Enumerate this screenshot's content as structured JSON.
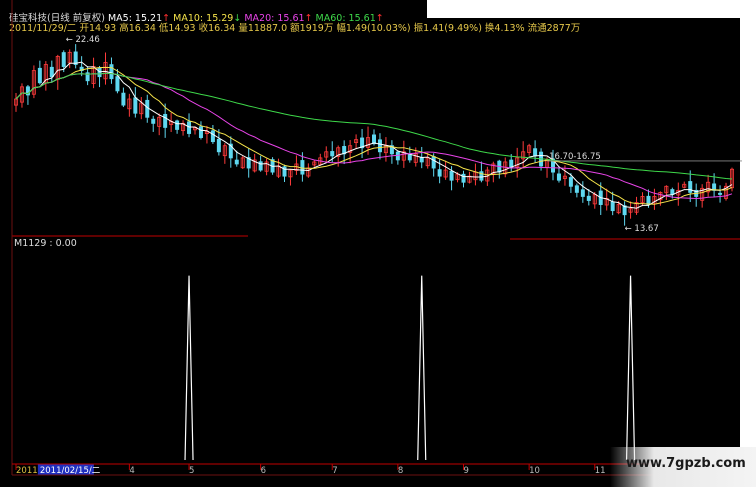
{
  "header": {
    "stock_name": "硅宝科技(日线 前复权)",
    "ma": [
      {
        "label": "MA5: 15.21",
        "arrow": "↑",
        "color": "#ffffff"
      },
      {
        "label": "MA10: 15.29",
        "arrow": "↓",
        "color": "#f5e34a"
      },
      {
        "label": "MA20: 15.61",
        "arrow": "↑",
        "color": "#e844e8"
      },
      {
        "label": "MA60: 15.61",
        "arrow": "↑",
        "color": "#3ed84a"
      }
    ],
    "bar_info": "2011/11/29/二 开14.93 高16.34 低14.93 收16.34 量11887.0 额1919万 幅1.49(10.03%) 振1.41(9.49%) 换4.13% 流通2877万"
  },
  "chart_data": {
    "type": "candlestick",
    "price": {
      "annotations": {
        "high": "← 22.46",
        "low": "← 13.67",
        "box": "16.70-16.75"
      },
      "series": [
        {
          "name": "MA5",
          "color": "#ffffff"
        },
        {
          "name": "MA10",
          "color": "#f5e34a"
        },
        {
          "name": "MA20",
          "color": "#e844e8"
        },
        {
          "name": "MA60",
          "color": "#3ed84a"
        }
      ],
      "close": [
        19.8,
        20.4,
        20.0,
        21.2,
        20.6,
        21.5,
        20.9,
        21.9,
        21.4,
        22.1,
        21.5,
        21.2,
        20.7,
        21.4,
        20.9,
        21.6,
        20.8,
        20.2,
        19.5,
        19.8,
        19.1,
        19.6,
        18.9,
        18.6,
        18.9,
        18.4,
        18.7,
        18.3,
        18.6,
        18.1,
        18.4,
        17.9,
        18.2,
        17.7,
        17.2,
        17.5,
        16.9,
        16.6,
        16.9,
        16.4,
        16.8,
        16.3,
        16.7,
        16.2,
        16.5,
        16.0,
        16.3,
        16.6,
        16.1,
        16.4,
        16.7,
        16.9,
        17.2,
        17.0,
        17.4,
        17.1,
        17.5,
        17.8,
        17.4,
        17.9,
        17.6,
        17.2,
        17.5,
        17.1,
        16.8,
        17.2,
        16.8,
        17.1,
        16.7,
        16.9,
        16.4,
        16.0,
        16.3,
        15.8,
        16.1,
        15.7,
        16.0,
        16.2,
        15.8,
        16.3,
        16.6,
        16.2,
        16.7,
        16.4,
        16.9,
        17.2,
        17.5,
        17.0,
        16.5,
        16.8,
        16.2,
        15.8,
        16.0,
        15.5,
        15.2,
        15.0,
        14.8,
        15.1,
        14.6,
        14.9,
        14.3,
        14.6,
        14.1,
        14.4,
        14.7,
        15.0,
        14.6,
        15.0,
        15.2,
        15.5,
        15.1,
        15.3,
        15.6,
        15.2,
        15.0,
        15.4,
        15.7,
        15.3,
        15.1,
        15.5,
        16.34
      ],
      "ylim": [
        13.2,
        23.2
      ]
    },
    "indicator": {
      "label": "M1129 : 0.00",
      "spike_index": [
        29,
        68,
        103
      ],
      "values": [
        0.0,
        1.0
      ],
      "ylim": [
        0,
        1.15
      ]
    },
    "x_ticks": [
      {
        "label": "2011",
        "index": 0
      },
      {
        "label": "2011/02/15/二",
        "index": 4
      },
      {
        "label": "4",
        "index": 19
      },
      {
        "label": "5",
        "index": 29
      },
      {
        "label": "6",
        "index": 41
      },
      {
        "label": "7",
        "index": 53
      },
      {
        "label": "8",
        "index": 64
      },
      {
        "label": "9",
        "index": 75
      },
      {
        "label": "10",
        "index": 86
      },
      {
        "label": "11",
        "index": 97
      }
    ],
    "grid": false
  },
  "watermark": {
    "text": "www.7gpzb.com"
  }
}
